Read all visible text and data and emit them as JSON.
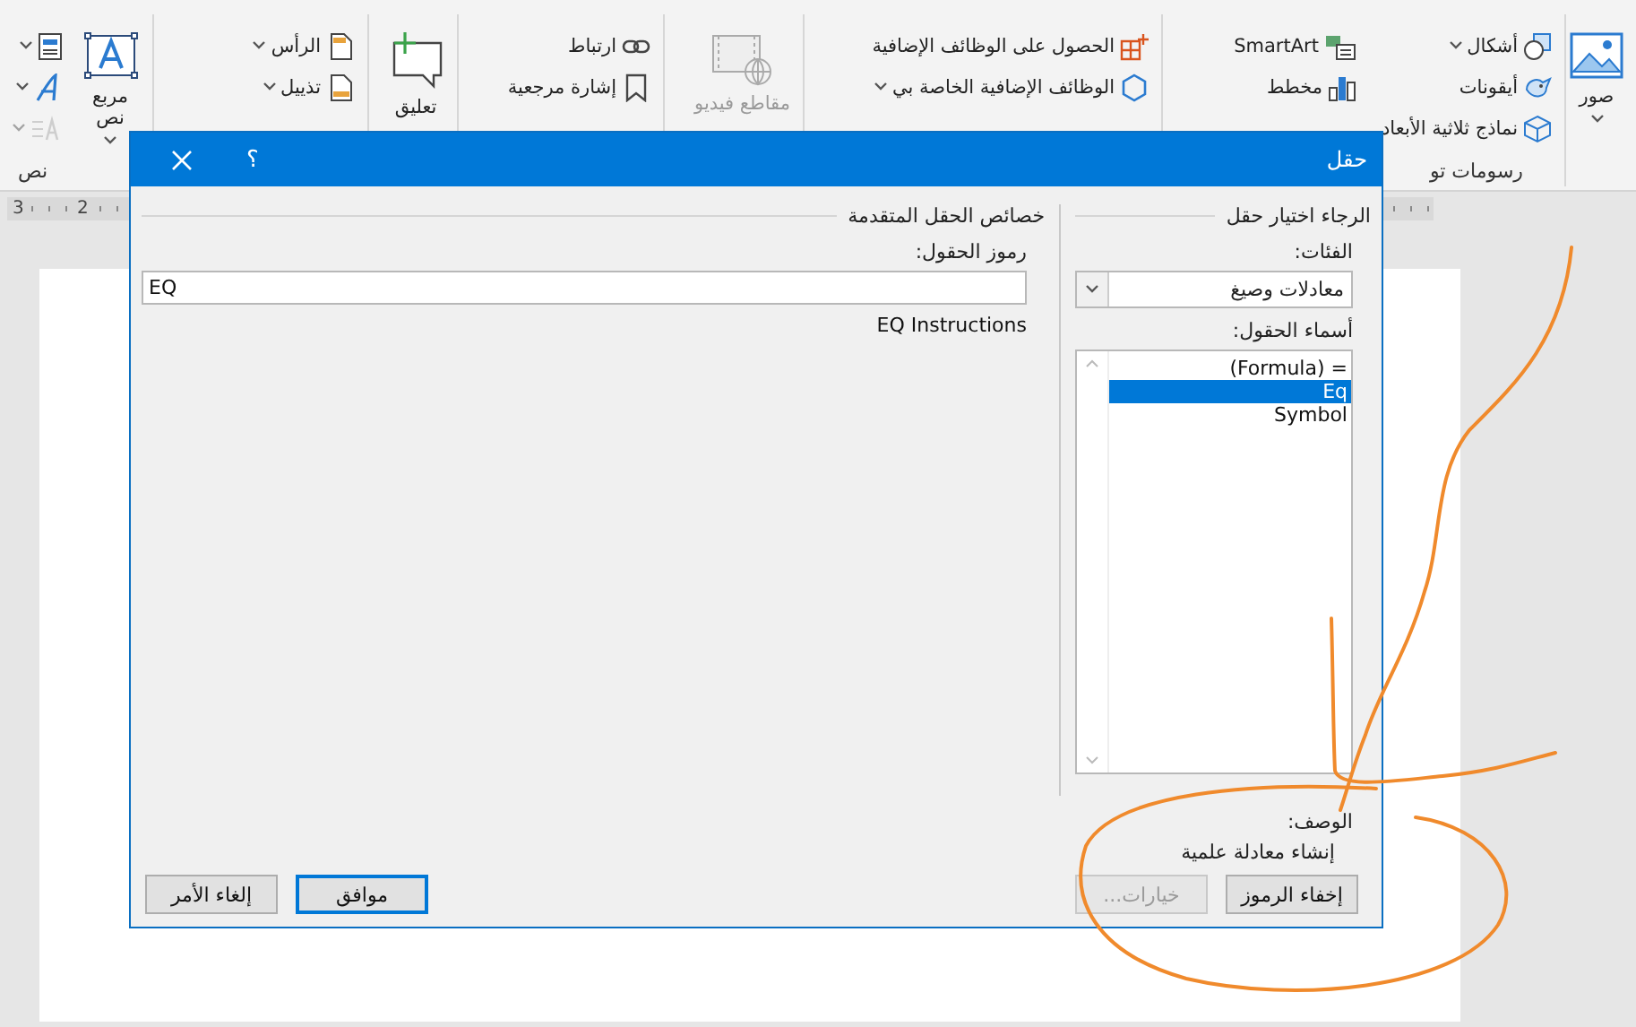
{
  "ribbon": {
    "groups": [
      {
        "items": [
          {
            "kind": "large",
            "label": "صور",
            "caret": true,
            "disabled": false
          }
        ]
      },
      {
        "label": "رسومات تو",
        "items": [
          {
            "kind": "small",
            "label": "أشكال",
            "caret": true,
            "disabled": false
          },
          {
            "kind": "small",
            "label": "أيقونات",
            "caret": false,
            "disabled": false
          },
          {
            "kind": "small",
            "label": "نماذج ثلاثية الأبعاد",
            "caret": false,
            "disabled": false
          },
          {
            "kind": "small",
            "label": "SmartArt",
            "caret": false,
            "disabled": false
          },
          {
            "kind": "small",
            "label": "مخطط",
            "caret": false,
            "disabled": false
          }
        ]
      },
      {
        "items": [
          {
            "kind": "small",
            "label": "الحصول على الوظائف الإضافية",
            "caret": false,
            "disabled": false
          },
          {
            "kind": "small",
            "label": "الوظائف الإضافية الخاصة بي",
            "caret": true,
            "disabled": false
          }
        ]
      },
      {
        "items": [
          {
            "kind": "large",
            "label": "مقاطع فيديو",
            "caret": false,
            "disabled": true
          }
        ]
      },
      {
        "items": [
          {
            "kind": "small",
            "label": "ارتباط",
            "caret": false,
            "disabled": false
          },
          {
            "kind": "small",
            "label": "إشارة مرجعية",
            "caret": false,
            "disabled": false
          }
        ]
      },
      {
        "items": [
          {
            "kind": "large",
            "label": "تعليق",
            "caret": false,
            "disabled": false
          }
        ]
      },
      {
        "items": [
          {
            "kind": "small",
            "label": "الرأس",
            "caret": true,
            "disabled": false
          },
          {
            "kind": "small",
            "label": "تذييل",
            "caret": true,
            "disabled": false
          }
        ]
      },
      {
        "label": "نص",
        "items": [
          {
            "kind": "large",
            "label": "مربع نص",
            "caret": true,
            "disabled": false
          },
          {
            "kind": "icon",
            "caret": true,
            "disabled": false
          },
          {
            "kind": "icon",
            "caret": true,
            "disabled": false
          },
          {
            "kind": "icon",
            "caret": true,
            "disabled": true
          }
        ]
      }
    ]
  },
  "ruler": {
    "numbers": [
      "2",
      "3"
    ]
  },
  "dialog": {
    "title": "حقل",
    "help": "؟",
    "choose": {
      "heading": "الرجاء اختيار حقل",
      "categories_label": "الفئات:",
      "category": "معادلات وصيغ",
      "names_label": "أسماء الحقول:",
      "field_names": [
        {
          "label": "= (Formula)",
          "selected": false
        },
        {
          "label": "Eq",
          "selected": true
        },
        {
          "label": "Symbol",
          "selected": false
        }
      ],
      "description_label": "الوصف:",
      "description": "إنشاء معادلة علمية",
      "buttons": [
        {
          "label": "إخفاء الرموز",
          "disabled": false
        },
        {
          "label": "خيارات...",
          "disabled": true
        }
      ]
    },
    "advanced": {
      "heading": "خصائص الحقل المتقدمة",
      "codes_label": "رموز الحقول:",
      "codes_value": "EQ",
      "instructions": "EQ Instructions"
    },
    "buttons": [
      {
        "label": "موافق",
        "default": true
      },
      {
        "label": "إلغاء الأمر",
        "default": false
      }
    ]
  }
}
